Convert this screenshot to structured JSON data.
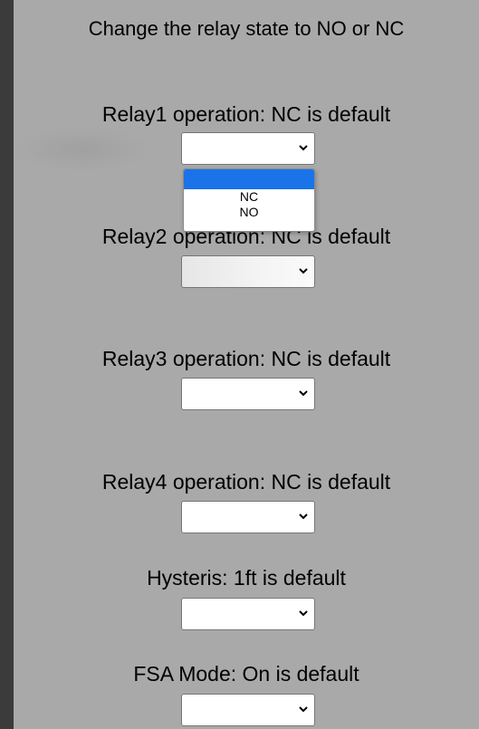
{
  "heading": "Change the relay state to NO or NC",
  "fields": [
    {
      "label": "Relay1 operation: NC is default",
      "value": ""
    },
    {
      "label": "Relay2 operation: NC is default",
      "value": ""
    },
    {
      "label": "Relay3 operation: NC is default",
      "value": ""
    },
    {
      "label": "Relay4 operation: NC is default",
      "value": ""
    },
    {
      "label": "Hysteris: 1ft is default",
      "value": ""
    },
    {
      "label": "FSA Mode: On is default",
      "value": ""
    }
  ],
  "open_dropdown": {
    "field_index": 0,
    "options": [
      "",
      "NC",
      "NO"
    ],
    "highlighted_index": 0
  },
  "colors": {
    "page_bg": "#3b3b3b",
    "panel_bg": "#a9a9a9",
    "highlight": "#1a73e8"
  }
}
